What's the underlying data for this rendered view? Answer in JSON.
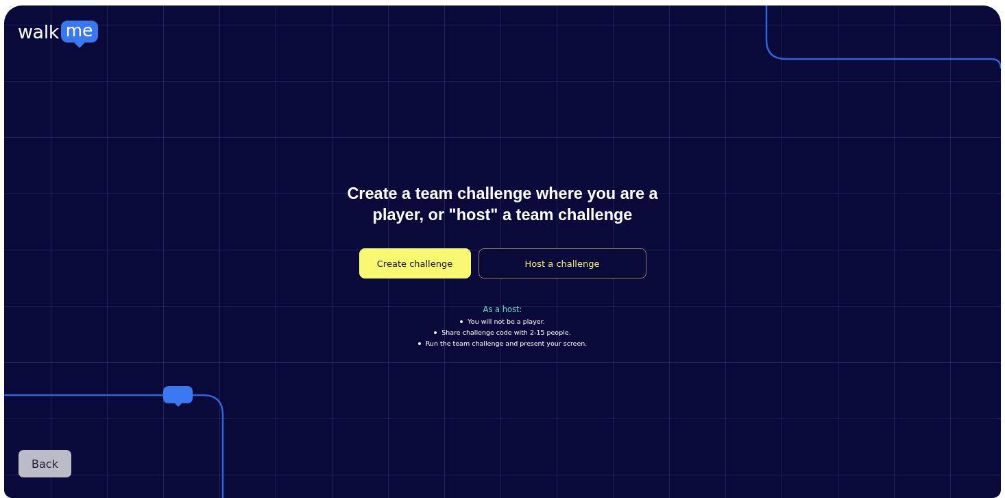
{
  "logo": {
    "word": "walk",
    "bubble": "me"
  },
  "heading": "Create a team challenge where you are a player, or \"host\" a team challenge",
  "buttons": [
    {
      "label": "Create challenge",
      "kind": "primary"
    },
    {
      "label": "Host a challenge",
      "kind": "outline"
    }
  ],
  "host_info": {
    "title": "As a host:",
    "items": [
      "You will not be a player.",
      "Share challenge code with 2-15 people.",
      "Run the team challenge and present your screen."
    ]
  },
  "back_button": "Back"
}
